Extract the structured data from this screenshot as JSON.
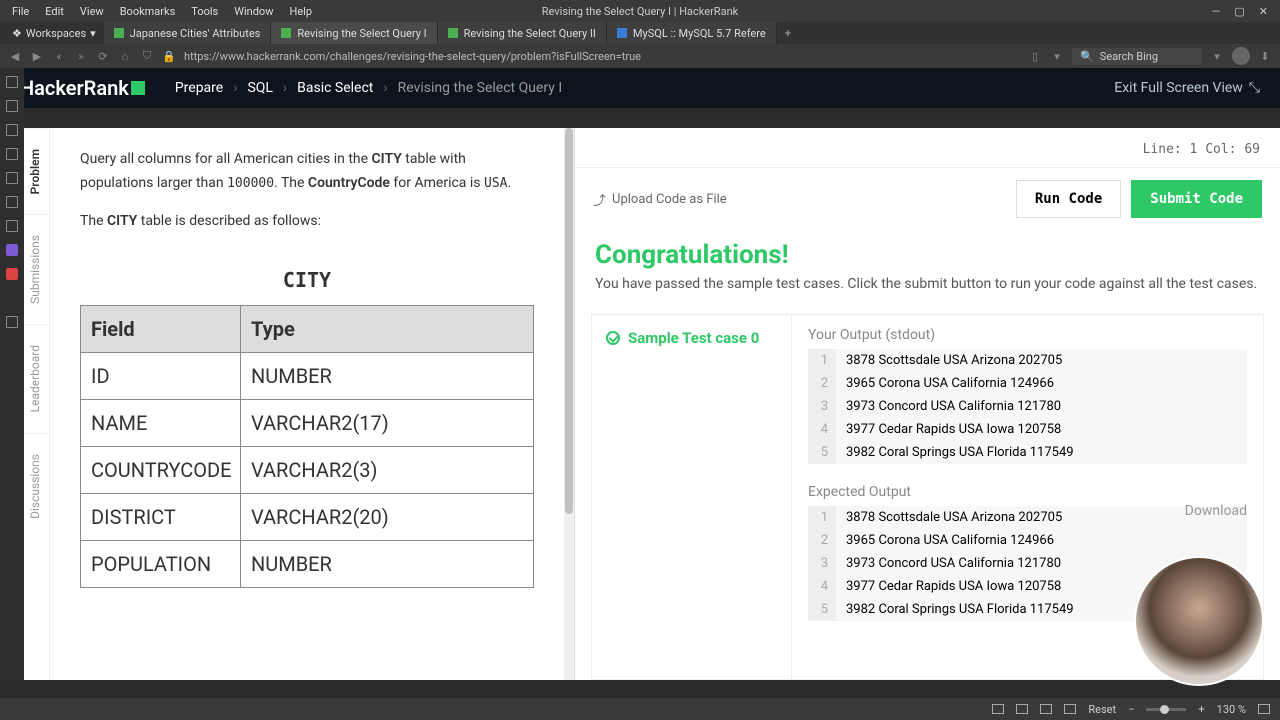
{
  "window": {
    "menus": [
      "File",
      "Edit",
      "View",
      "Bookmarks",
      "Tools",
      "Window",
      "Help"
    ],
    "title": "Revising the Select Query I | HackerRank"
  },
  "tabs": {
    "workspaces": "Workspaces",
    "items": [
      "Japanese Cities' Attributes",
      "Revising the Select Query I",
      "Revising the Select Query II",
      "MySQL :: MySQL 5.7 Refere"
    ]
  },
  "url": {
    "value": "https://www.hackerrank.com/challenges/revising-the-select-query/problem?isFullScreen=true",
    "search_placeholder": "Search Bing"
  },
  "hr_header": {
    "logo": "HackerRank",
    "breadcrumbs": [
      "Prepare",
      "SQL",
      "Basic Select",
      "Revising the Select Query I"
    ],
    "exit": "Exit Full Screen View"
  },
  "side_tabs": [
    "Problem",
    "Submissions",
    "Leaderboard",
    "Discussions"
  ],
  "problem": {
    "p1_a": "Query all columns for all American cities in the ",
    "p1_bold1": "CITY",
    "p1_b": " table with populations larger than ",
    "p1_code": "100000",
    "p1_c": ". The ",
    "p1_bold2": "CountryCode",
    "p1_d": " for America is ",
    "p1_code2": "USA",
    "p1_e": ".",
    "p2_a": "The ",
    "p2_bold": "CITY",
    "p2_b": " table is described as follows:",
    "table_title": "CITY",
    "table_headers": [
      "Field",
      "Type"
    ],
    "table_rows": [
      [
        "ID",
        "NUMBER"
      ],
      [
        "NAME",
        "VARCHAR2(17)"
      ],
      [
        "COUNTRYCODE",
        "VARCHAR2(3)"
      ],
      [
        "DISTRICT",
        "VARCHAR2(20)"
      ],
      [
        "POPULATION",
        "NUMBER"
      ]
    ]
  },
  "editor": {
    "status": "Line: 1 Col: 69"
  },
  "actions": {
    "upload": "Upload Code as File",
    "run": "Run Code",
    "submit": "Submit Code"
  },
  "result": {
    "title": "Congratulations!",
    "subtitle": "You have passed the sample test cases. Click the submit button to run your code against all the test cases.",
    "testcase": "Sample Test case 0",
    "your_output_label": "Your Output (stdout)",
    "expected_label": "Expected Output",
    "download": "Download",
    "your_output": [
      "3878 Scottsdale USA Arizona 202705",
      "3965 Corona USA California 124966",
      "3973 Concord USA California 121780",
      "3977 Cedar Rapids USA Iowa 120758",
      "3982 Coral Springs USA Florida 117549"
    ],
    "expected_output": [
      "3878 Scottsdale USA Arizona 202705",
      "3965 Corona USA California 124966",
      "3973 Concord USA California 121780",
      "3977 Cedar Rapids USA Iowa 120758",
      "3982 Coral Springs USA Florida 117549"
    ]
  },
  "statusbar": {
    "reset": "Reset",
    "zoom": "130 %"
  }
}
